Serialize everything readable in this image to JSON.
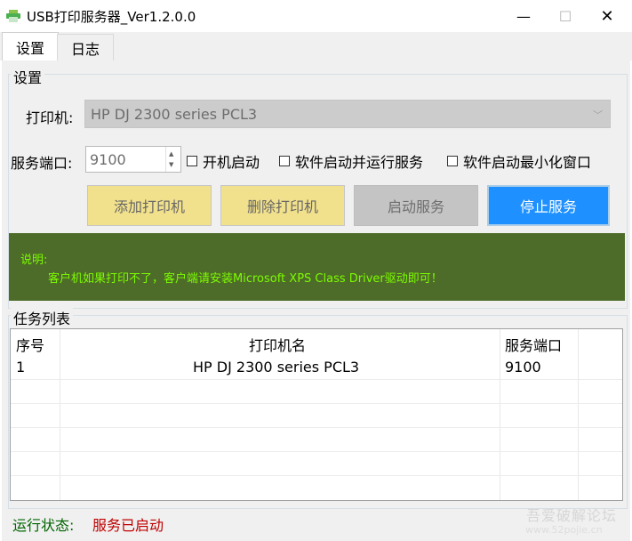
{
  "window": {
    "title": "USB打印服务器_Ver1.2.0.0",
    "min_glyph": "—",
    "max_glyph": "☐",
    "close_glyph": "✕",
    "icon": "printer-icon"
  },
  "tabs": [
    {
      "label": "设置",
      "active": true
    },
    {
      "label": "日志",
      "active": false
    }
  ],
  "settings": {
    "group_title": "设置",
    "printer_label": "打印机:",
    "printer_value": "HP DJ 2300 series PCL3",
    "port_label": "服务端口:",
    "port_value": "9100",
    "checkboxes": [
      {
        "label": "开机启动",
        "checked": false
      },
      {
        "label": "软件启动并运行服务",
        "checked": false
      },
      {
        "label": "软件启动最小化窗口",
        "checked": false
      }
    ],
    "buttons": {
      "add": "添加打印机",
      "delete": "删除打印机",
      "start": "启动服务",
      "stop": "停止服务"
    }
  },
  "notice": {
    "title": "说明:",
    "text": "客户机如果打印不了，客户端请安装Microsoft XPS Class Driver驱动即可！"
  },
  "tasks": {
    "group_title": "任务列表",
    "columns": [
      "序号",
      "打印机名",
      "服务端口"
    ],
    "rows": [
      {
        "no": "1",
        "name": "HP DJ 2300 series PCL3",
        "port": "9100"
      }
    ]
  },
  "status": {
    "label": "运行状态:",
    "value": "服务已启动"
  },
  "watermark": {
    "text": "吾爱破解论坛",
    "url": "www.52pojie.cn"
  },
  "colors": {
    "accent_blue": "#1e90ff",
    "button_yellow": "#f2e18c",
    "notice_bg": "#4d6b29",
    "notice_text": "#7cfc00",
    "status_ok": "#c00000"
  }
}
